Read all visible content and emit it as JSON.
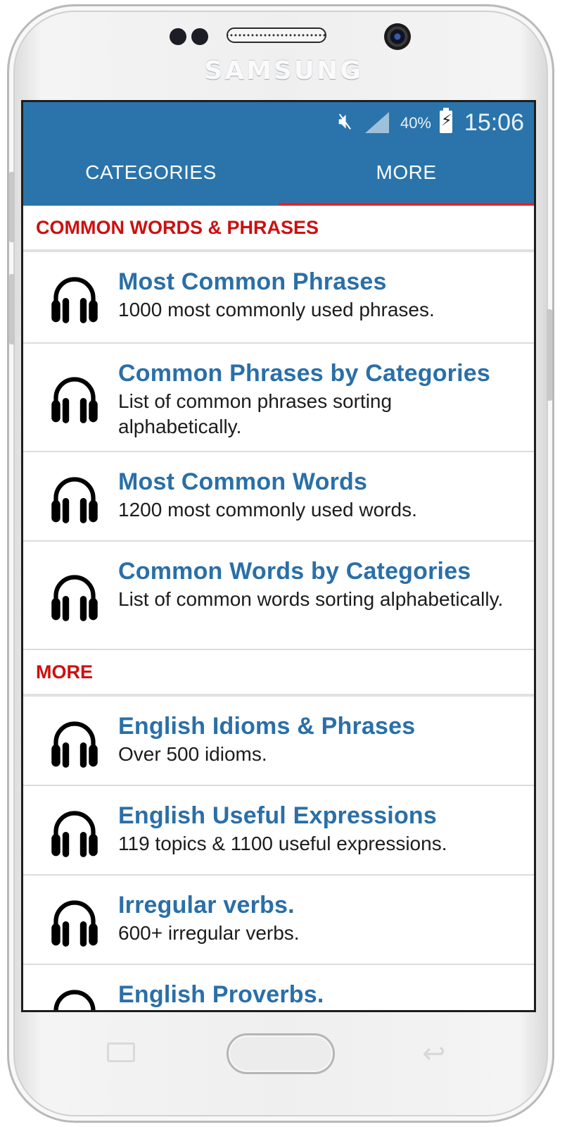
{
  "device": {
    "brand": "SAMSUNG"
  },
  "status_bar": {
    "battery_percent": "40%",
    "time": "15:06"
  },
  "tabs": [
    {
      "label": "CATEGORIES",
      "active": false
    },
    {
      "label": "MORE",
      "active": true
    }
  ],
  "sections": [
    {
      "header": "COMMON WORDS & PHRASES",
      "items": [
        {
          "title": "Most Common Phrases",
          "subtitle": "1000 most commonly used phrases."
        },
        {
          "title": "Common Phrases by Categories",
          "subtitle": "List of common phrases sorting alphabetically."
        },
        {
          "title": "Most Common Words",
          "subtitle": "1200 most commonly used words."
        },
        {
          "title": "Common Words by Categories",
          "subtitle": "List of common words sorting alphabetically."
        }
      ]
    },
    {
      "header": "MORE",
      "items": [
        {
          "title": "English Idioms & Phrases",
          "subtitle": "Over 500 idioms."
        },
        {
          "title": "English Useful Expressions",
          "subtitle": "119 topics & 1100 useful expressions."
        },
        {
          "title": "Irregular verbs.",
          "subtitle": "600+ irregular verbs."
        },
        {
          "title": "English Proverbs.",
          "subtitle": ""
        }
      ]
    }
  ],
  "colors": {
    "app_bar": "#2a74ab",
    "tab_indicator": "#e8202a",
    "section_header": "#cc1010",
    "item_title": "#2a6fa8"
  },
  "icons": {
    "list_item": "headphones-icon",
    "status": [
      "mute-icon",
      "signal-icon",
      "battery-charging-icon"
    ]
  }
}
